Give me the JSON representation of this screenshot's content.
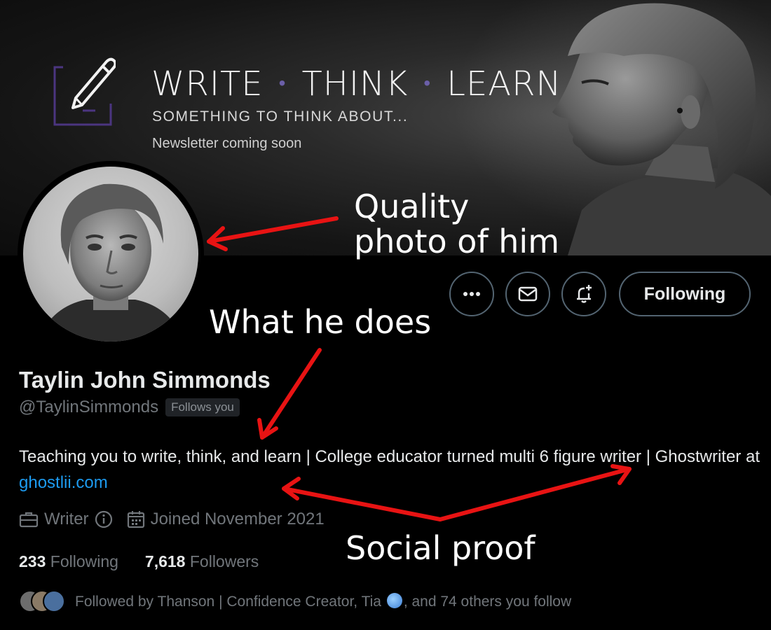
{
  "banner": {
    "title_words": [
      "WRITE",
      "THINK",
      "LEARN"
    ],
    "separator": "•",
    "subtitle": "SOMETHING TO THINK ABOUT...",
    "note": "Newsletter coming soon",
    "logo_icon": "pencil-document-icon",
    "accent_color": "#6b4fa8"
  },
  "actions": {
    "more_icon": "more-icon",
    "message_icon": "mail-icon",
    "notify_icon": "bell-plus-icon",
    "following_label": "Following"
  },
  "profile": {
    "name": "Taylin John Simmonds",
    "handle": "@TaylinSimmonds",
    "follows_badge": "Follows you",
    "bio_text": "Teaching you to write, think, and learn | College educator turned multi 6 figure writer | Ghostwriter at ",
    "bio_link": "ghostlii.com",
    "profession": "Writer",
    "joined": "Joined November 2021",
    "following_count": "233",
    "following_label": "Following",
    "followers_count": "7,618",
    "followers_label": "Followers",
    "followed_by_prefix": "Followed by Thanson | Confidence Creator, Tia",
    "followed_by_suffix": ", and 74 others you follow"
  },
  "annotations": {
    "photo": "Quality photo of him",
    "photo_line1": "Quality",
    "photo_line2": "photo of him",
    "does": "What he does",
    "proof": "Social proof",
    "arrow_color": "#e81313"
  }
}
